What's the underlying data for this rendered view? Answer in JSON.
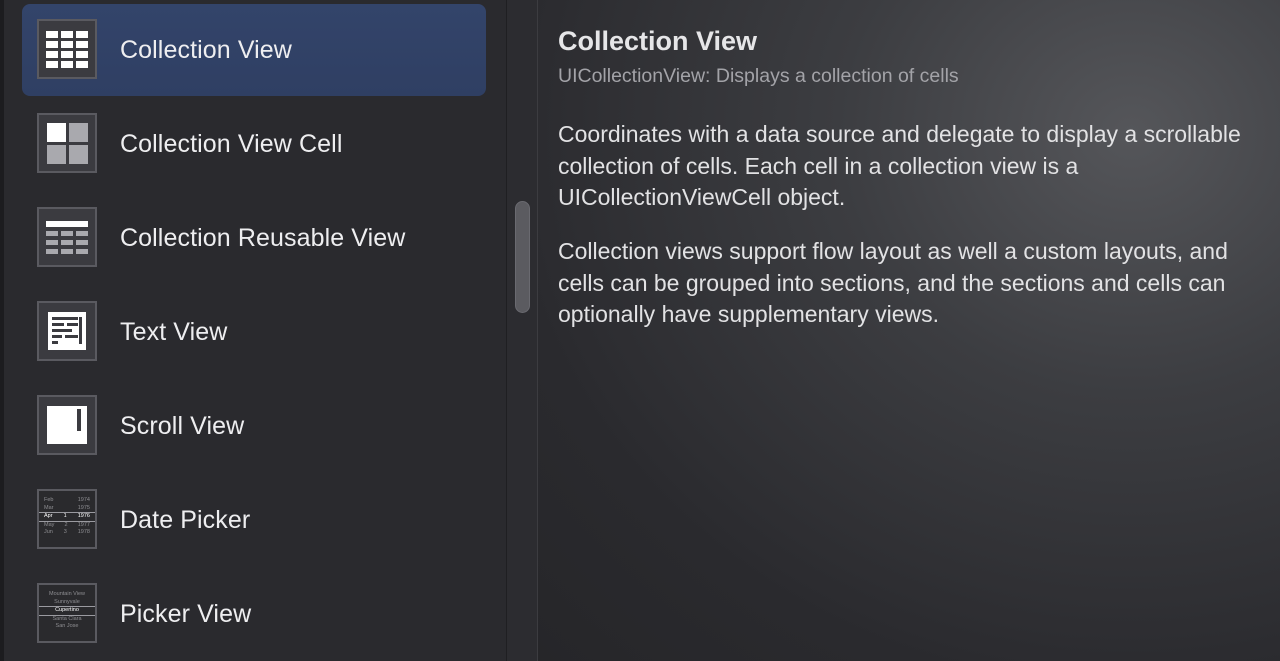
{
  "library": {
    "items": [
      {
        "label": "Collection View",
        "icon": "collection-view-icon",
        "selected": true
      },
      {
        "label": "Collection View Cell",
        "icon": "collection-view-cell-icon",
        "selected": false
      },
      {
        "label": "Collection Reusable View",
        "icon": "collection-reusable-view-icon",
        "selected": false
      },
      {
        "label": "Text View",
        "icon": "text-view-icon",
        "selected": false
      },
      {
        "label": "Scroll View",
        "icon": "scroll-view-icon",
        "selected": false
      },
      {
        "label": "Date Picker",
        "icon": "date-picker-icon",
        "selected": false
      },
      {
        "label": "Picker View",
        "icon": "picker-view-icon",
        "selected": false
      }
    ],
    "date_picker_thumb": {
      "rows": [
        {
          "month": "Feb",
          "day": "",
          "year": "1974"
        },
        {
          "month": "Mar",
          "day": "",
          "year": "1975"
        },
        {
          "month": "Apr",
          "day": "1",
          "year": "1976"
        },
        {
          "month": "May",
          "day": "2",
          "year": "1977"
        },
        {
          "month": "Jun",
          "day": "3",
          "year": "1978"
        }
      ]
    },
    "picker_view_thumb": {
      "rows": [
        "Mountain View",
        "Sunnyvale",
        "Cupertino",
        "Santa Clara",
        "San Jose"
      ]
    }
  },
  "detail": {
    "title": "Collection View",
    "subtitle": "UICollectionView: Displays a collection of cells",
    "paragraphs": [
      "Coordinates with a data source and delegate to display a scrollable collection of cells. Each cell in a collection view is a UICollectionViewCell object.",
      "Collection views support flow layout as well a custom layouts, and cells can be grouped into sections, and the sections and cells can optionally have supplementary views."
    ]
  },
  "colors": {
    "selection": "#33446a",
    "sidebar_bg": "#2a2a2e",
    "text_primary": "#eeeef0",
    "text_secondary": "#a3a3a8"
  }
}
